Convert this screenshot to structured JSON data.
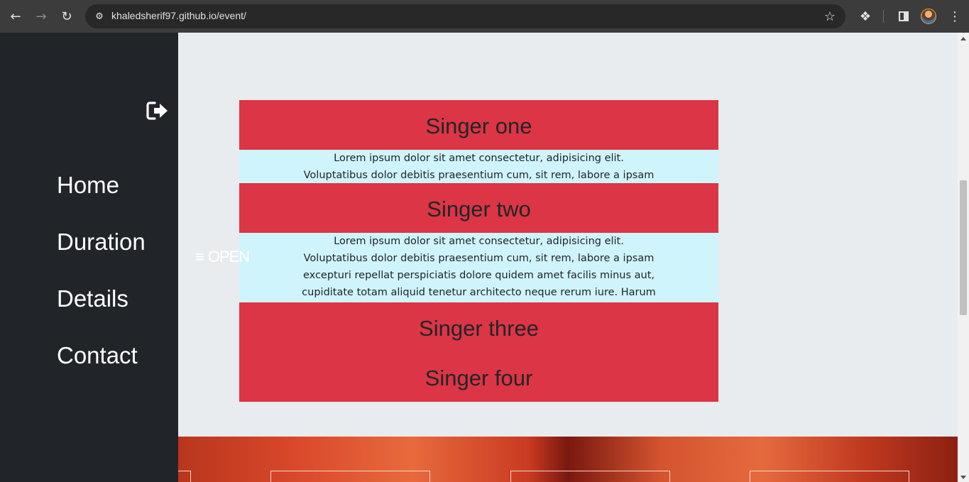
{
  "browser": {
    "url": "khaledsherif97.github.io/event/"
  },
  "sidebar": {
    "items": [
      {
        "label": "Home"
      },
      {
        "label": "Duration"
      },
      {
        "label": "Details"
      },
      {
        "label": "Contact"
      }
    ]
  },
  "toggle": {
    "label": "OPEN"
  },
  "accordion": {
    "items": [
      {
        "title": "Singer one",
        "body": "Lorem ipsum dolor sit amet consectetur, adipisicing elit. Voluptatibus dolor debitis praesentium cum, sit rem, labore a ipsam excepturi"
      },
      {
        "title": "Singer two",
        "body": "Lorem ipsum dolor sit amet consectetur, adipisicing elit. Voluptatibus dolor debitis praesentium cum, sit rem, labore a ipsam excepturi repellat perspiciatis dolore quidem amet facilis minus aut, cupiditate totam aliquid tenetur architecto neque rerum iure. Harum expedita"
      },
      {
        "title": "Singer three"
      },
      {
        "title": "Singer four"
      }
    ]
  },
  "colors": {
    "sidebar_bg": "#212529",
    "accordion_head": "#dc3545",
    "accordion_body": "#cff4fc",
    "page_bg": "#e9ecef"
  }
}
